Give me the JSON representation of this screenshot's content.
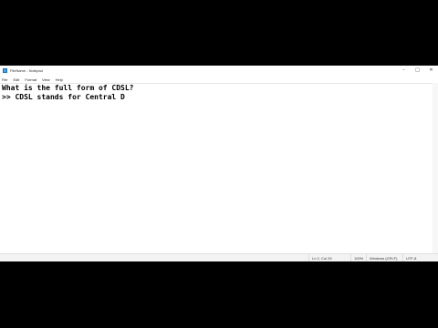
{
  "window": {
    "title": "FileName - Notepad",
    "minimize_glyph": "–",
    "maximize_glyph": "□",
    "close_glyph": "✕"
  },
  "menu": {
    "items": [
      "File",
      "Edit",
      "Format",
      "View",
      "Help"
    ]
  },
  "editor": {
    "lines": [
      "What is the full form of CDSL?",
      ">> CDSL stands for Central D"
    ]
  },
  "status": {
    "position": "Ln 2, Col 29",
    "zoom": "100%",
    "line_ending": "Windows (CRLF)",
    "encoding": "UTF-8"
  }
}
